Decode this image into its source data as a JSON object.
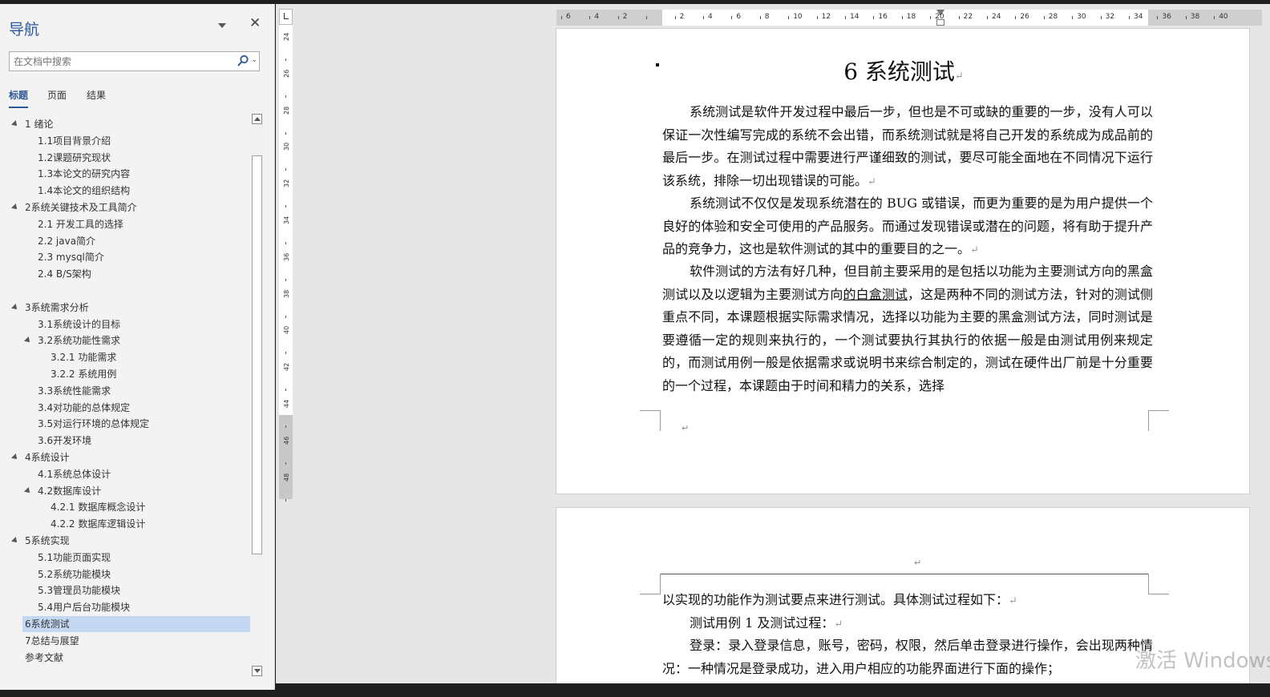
{
  "nav": {
    "title": "导航",
    "search_placeholder": "在文档中搜索",
    "tabs": [
      {
        "label": "标题",
        "active": true
      },
      {
        "label": "页面",
        "active": false
      },
      {
        "label": "结果",
        "active": false
      }
    ],
    "tree": [
      {
        "label": "1 绪论",
        "level": 1,
        "expanded": true
      },
      {
        "label": "1.1项目背景介绍",
        "level": 2
      },
      {
        "label": "1.2课题研究现状",
        "level": 2
      },
      {
        "label": "1.3本论文的研究内容",
        "level": 2
      },
      {
        "label": "1.4本论文的组织结构",
        "level": 2
      },
      {
        "label": "2系统关键技术及工具简介",
        "level": 1,
        "expanded": true
      },
      {
        "label": "2.1 开发工具的选择",
        "level": 2
      },
      {
        "label": "2.2 java简介",
        "level": 2
      },
      {
        "label": "2.3 mysql简介",
        "level": 2
      },
      {
        "label": "2.4 B/S架构",
        "level": 2
      },
      {
        "label": "",
        "level": 2
      },
      {
        "label": "3系统需求分析",
        "level": 1,
        "expanded": true
      },
      {
        "label": "3.1系统设计的目标",
        "level": 2
      },
      {
        "label": "3.2系统功能性需求",
        "level": 2,
        "expanded": true
      },
      {
        "label": "3.2.1 功能需求",
        "level": 3
      },
      {
        "label": "3.2.2 系统用例",
        "level": 3
      },
      {
        "label": "3.3系统性能需求",
        "level": 2
      },
      {
        "label": "3.4对功能的总体规定",
        "level": 2
      },
      {
        "label": "3.5对运行环境的总体规定",
        "level": 2
      },
      {
        "label": "3.6开发环境",
        "level": 2
      },
      {
        "label": "4系统设计",
        "level": 1,
        "expanded": true
      },
      {
        "label": "4.1系统总体设计",
        "level": 2
      },
      {
        "label": "4.2数据库设计",
        "level": 2,
        "expanded": true
      },
      {
        "label": "4.2.1 数据库概念设计",
        "level": 3
      },
      {
        "label": "4.2.2 数据库逻辑设计",
        "level": 3
      },
      {
        "label": "5系统实现",
        "level": 1,
        "expanded": true
      },
      {
        "label": "5.1功能页面实现",
        "level": 2
      },
      {
        "label": "5.2系统功能模块",
        "level": 2
      },
      {
        "label": "5.3管理员功能模块",
        "level": 2
      },
      {
        "label": "5.4用户后台功能模块",
        "level": 2
      },
      {
        "label": "6系统测试",
        "level": 1,
        "selected": true
      },
      {
        "label": "7总结与展望",
        "level": 1
      },
      {
        "label": "参考文献",
        "level": 1
      }
    ]
  },
  "ruler": {
    "horizontal": [
      "6",
      "4",
      "2",
      "",
      "2",
      "4",
      "6",
      "8",
      "10",
      "12",
      "14",
      "16",
      "18",
      "20",
      "22",
      "24",
      "26",
      "28",
      "30",
      "32",
      "34",
      "36",
      "38",
      "40"
    ],
    "vertical": [
      "24",
      "26",
      "28",
      "30",
      "32",
      "34",
      "36",
      "38",
      "40",
      "42",
      "44",
      "46",
      "48"
    ]
  },
  "document": {
    "heading": "6 系统测试",
    "page1_paragraphs": [
      "系统测试是软件开发过程中最后一步，但也是不可或缺的重要的一步，没有人可以保证一次性编写完成的系统不会出错，而系统测试就是将自己开发的系统成为成品前的最后一步。在测试过程中需要进行严谨细致的测试，要尽可能全面地在不同情况下运行该系统，排除一切出现错误的可能。",
      "系统测试不仅仅是发现系统潜在的 BUG 或错误，而更为重要的是为用户提供一个良好的体验和安全可使用的产品服务。而通过发现错误或潜在的问题，将有助于提升产品的竞争力，这也是软件测试的其中的重要目的之一。"
    ],
    "page1_para3": {
      "before": "软件测试的方法有好几种，但目前主要采用的是包括以功能为主要测试方向的黑盒测试以及以逻辑为主要测试方向",
      "underlined": "的白盒测试",
      "after": "，这是两种不同的测试方法，针对的测试侧重点不同，本课题根据实际需求情况，选择以功能为主要的黑盒测试方法，同时测试是要遵循一定的规则来执行的，一个测试要执行其执行的依据一般是由测试用例来规定的，而测试用例一般是依据需求或说明书来综合制定的，测试在硬件出厂前是十分重要的一个过程，本课题由于时间和精力的关系，选择"
    },
    "page2_lines": [
      "以实现的功能作为测试要点来进行测试。具体测试过程如下：",
      "测试用例 1 及测试过程：",
      "登录：录入登录信息，账号，密码，权限，然后单击登录进行操作，会出现两种情况：一种情况是登录成功，进入用户相应的功能界面进行下面的操作；"
    ],
    "paragraph_mark": "↵"
  },
  "watermark": "激活 Windows",
  "colors": {
    "accent": "#2b579a",
    "selected": "#c5d8f3"
  }
}
